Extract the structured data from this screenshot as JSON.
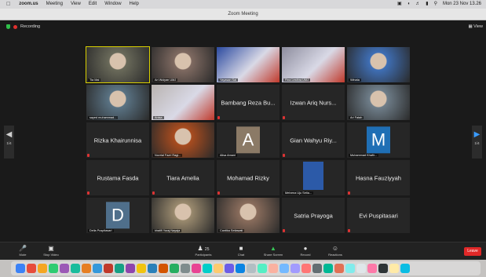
{
  "menubar": {
    "items": [
      "zoom.us",
      "Meeting",
      "View",
      "Edit",
      "Window",
      "Help"
    ],
    "clock": "Mon 23 Nov 13.26"
  },
  "window": {
    "title": "Zoom Meeting"
  },
  "meeting": {
    "recording": "Recording",
    "view_label": "View"
  },
  "tiles": [
    {
      "name": "",
      "label": "Tia Mai",
      "kind": "video",
      "active": true,
      "tone": "#6a6a5a"
    },
    {
      "name": "",
      "label": "Ari Wulyan UMJ",
      "kind": "video",
      "tone": "#7f6a61"
    },
    {
      "name": "",
      "label": "Yayasan Sai",
      "kind": "banner",
      "tone": "#2b4aa0"
    },
    {
      "name": "",
      "label": "Fina Lesthra UMJ",
      "kind": "banner",
      "tone": "#8d8d9e"
    },
    {
      "name": "",
      "label": "Winata",
      "kind": "video",
      "tone": "#3f6fb6"
    },
    {
      "name": "",
      "label": "sayed muhammad...",
      "kind": "video",
      "tone": "#5a7384"
    },
    {
      "name": "",
      "label": "Anisa",
      "kind": "banner",
      "tone": "#b9b3b0"
    },
    {
      "name": "Bambang Reza Bu...",
      "label": "",
      "kind": "text"
    },
    {
      "name": "Izwan Ariq Nurs...",
      "label": "",
      "kind": "text"
    },
    {
      "name": "",
      "label": "Ari Fatah",
      "kind": "video",
      "tone": "#6f7e8a"
    },
    {
      "name": "Rizka Khairunnisa",
      "label": "",
      "kind": "text"
    },
    {
      "name": "",
      "label": "Novrial Fazri Ragi...",
      "kind": "video",
      "tone": "#a94c1f"
    },
    {
      "name": "",
      "label": "Alisa Amani",
      "kind": "avatar",
      "letter": "A",
      "tone": "#8b7a66"
    },
    {
      "name": "Gian Wahyu Riy...",
      "label": "",
      "kind": "text"
    },
    {
      "name": "",
      "label": "Muhammad Khafir...",
      "kind": "avatar",
      "letter": "M",
      "tone": "#1f6fb5"
    },
    {
      "name": "Rustama Fasda",
      "label": "",
      "kind": "text"
    },
    {
      "name": "Tiara Amelia",
      "label": "",
      "kind": "text"
    },
    {
      "name": "Mohamad Rizky",
      "label": "",
      "kind": "text"
    },
    {
      "name": "",
      "label": "Melvena Uju Setia...",
      "kind": "photo",
      "tone": "#2c5aa8"
    },
    {
      "name": "Hasna Fauziyyah",
      "label": "",
      "kind": "text"
    },
    {
      "name": "",
      "label": "Della Puspitasari",
      "kind": "avatar",
      "letter": "D",
      "tone": "#4f6f8b"
    },
    {
      "name": "",
      "label": "khalifi Yuraj Nayaja",
      "kind": "video",
      "tone": "#9a8a6e"
    },
    {
      "name": "",
      "label": "Cantika Setiawati",
      "kind": "video",
      "tone": "#8a6d5c"
    },
    {
      "name": "Satria Prayoga",
      "label": "",
      "kind": "text"
    },
    {
      "name": "Evi Puspitasari",
      "label": "",
      "kind": "text"
    }
  ],
  "controls": {
    "mute": "Mute",
    "stop_video": "Stop Video",
    "participants": "Participants",
    "participants_count": "25",
    "chat": "Chat",
    "share": "Share Screen",
    "record": "Record",
    "reactions": "Reactions",
    "leave": "Leave"
  },
  "nav": {
    "left_page": "1/4",
    "right_page": "1/4"
  },
  "dock_colors": [
    "#3b82f6",
    "#e74c3c",
    "#f5a623",
    "#2ecc71",
    "#9b59b6",
    "#1abc9c",
    "#e67e22",
    "#3498db",
    "#c0392b",
    "#16a085",
    "#8e44ad",
    "#f1c40f",
    "#2980b9",
    "#d35400",
    "#27ae60",
    "#7f8c8d",
    "#e84393",
    "#00cec9",
    "#fdcb6e",
    "#6c5ce7",
    "#0984e3",
    "#b2bec3",
    "#55efc4",
    "#fab1a0",
    "#74b9ff",
    "#a29bfe",
    "#ff7675",
    "#636e72",
    "#00b894",
    "#e17055",
    "#81ecec",
    "#dfe6e9",
    "#fd79a8",
    "#2d3436",
    "#ffeaa7",
    "#0abde3"
  ]
}
